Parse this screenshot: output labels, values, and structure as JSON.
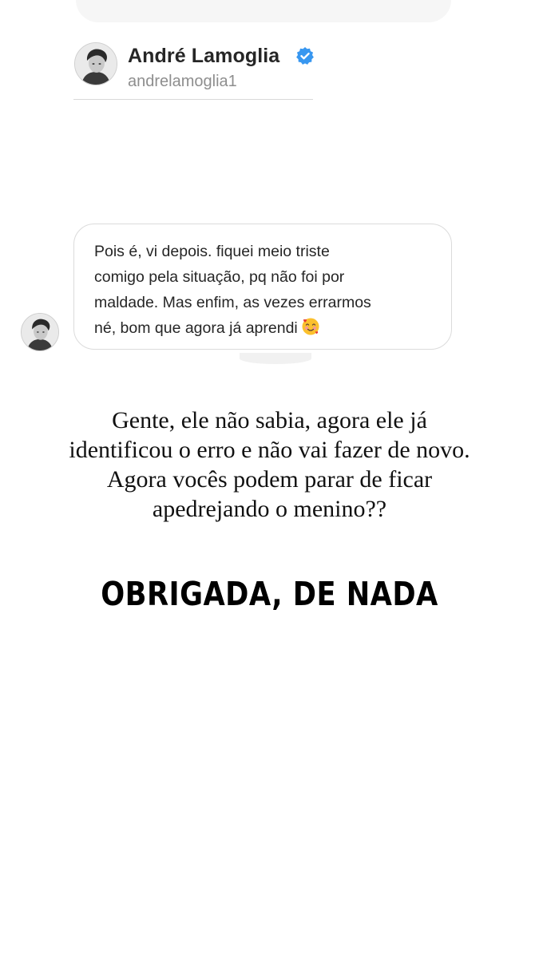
{
  "profile": {
    "name": "André Lamoglia",
    "handle": "andrelamoglia1",
    "verified_icon": "verified-badge-icon",
    "verified_color": "#3897f0"
  },
  "message": {
    "text": "Pois é, vi depois. fiquei meio triste\ncomigo pela situação, pq não foi por\nmaldade. Mas enfim, as vezes errarmos\nné, bom que agora já aprendi",
    "emoji": "smiling-face-with-hearts-icon"
  },
  "caption": {
    "text": "Gente, ele não sabia, agora ele já\nidentificou o erro e não vai fazer de novo.\nAgora vocês podem parar de ficar\napedrejando o menino??"
  },
  "shout": {
    "text": "OBRIGADA, DE NADA"
  }
}
